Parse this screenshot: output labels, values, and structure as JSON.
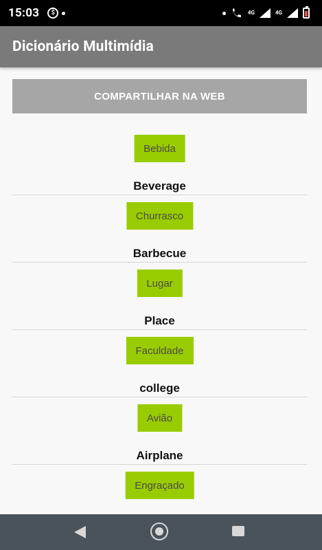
{
  "status_bar": {
    "time": "15:03",
    "network_label_top": "4G",
    "network_label_bottom": "4G"
  },
  "app_bar": {
    "title": "Dicionário Multimídia"
  },
  "share_button": {
    "label": "COMPARTILHAR NA WEB"
  },
  "entries": [
    {
      "word": "Bebida",
      "translation": "Beverage"
    },
    {
      "word": "Churrasco",
      "translation": "Barbecue"
    },
    {
      "word": "Lugar",
      "translation": "Place"
    },
    {
      "word": "Faculdade",
      "translation": "college"
    },
    {
      "word": "Avião",
      "translation": "Airplane"
    },
    {
      "word": "Engraçado",
      "translation": ""
    }
  ],
  "colors": {
    "word_button": "#99cc00",
    "app_bar": "#7a7a7a",
    "share_button": "#a6a6a6",
    "nav_bar": "#4a525a"
  },
  "icons": {
    "status_left": [
      "data-saver-icon",
      "notification-dot-icon"
    ],
    "status_right": [
      "dot-icon",
      "wifi-call-icon",
      "signal-icon",
      "signal-icon",
      "battery-icon"
    ],
    "navigation": [
      "back-icon",
      "home-icon",
      "recents-icon"
    ]
  }
}
